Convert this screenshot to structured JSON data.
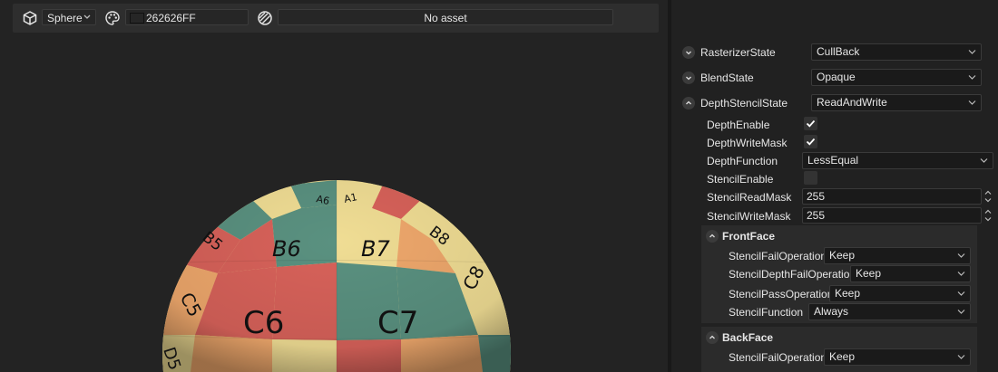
{
  "toolbar": {
    "shape_value": "Sphere",
    "color_value": "262626FF",
    "color_swatch": "#262626",
    "asset_value": "No asset"
  },
  "sphere_tiles": {
    "row_a": [
      "A6",
      "A1"
    ],
    "row_b": [
      "B5",
      "B6",
      "B7",
      "B8"
    ],
    "row_c": [
      "C5",
      "C6",
      "C7",
      "C8"
    ],
    "row_d": [
      "D5"
    ],
    "colors": {
      "red": "#d8625a",
      "teal": "#5a9180",
      "yellow": "#f0dd94",
      "orange": "#efa86c"
    }
  },
  "props": {
    "rasterizer": {
      "label": "RasterizerState",
      "value": "CullBack"
    },
    "blend": {
      "label": "BlendState",
      "value": "Opaque"
    },
    "depth_stencil": {
      "label": "DepthStencilState",
      "value": "ReadAndWrite",
      "depth_enable": {
        "label": "DepthEnable",
        "checked": true
      },
      "depth_write_mask": {
        "label": "DepthWriteMask",
        "checked": true
      },
      "depth_function": {
        "label": "DepthFunction",
        "value": "LessEqual"
      },
      "stencil_enable": {
        "label": "StencilEnable",
        "checked": false
      },
      "stencil_read_mask": {
        "label": "StencilReadMask",
        "value": "255"
      },
      "stencil_write_mask": {
        "label": "StencilWriteMask",
        "value": "255"
      },
      "front_face": {
        "label": "FrontFace",
        "fail_op": {
          "label": "StencilFailOperation",
          "value": "Keep"
        },
        "depth_fail_op": {
          "label": "StencilDepthFailOperation",
          "value": "Keep"
        },
        "pass_op": {
          "label": "StencilPassOperation",
          "value": "Keep"
        },
        "function": {
          "label": "StencilFunction",
          "value": "Always"
        }
      },
      "back_face": {
        "label": "BackFace",
        "fail_op": {
          "label": "StencilFailOperation",
          "value": "Keep"
        }
      }
    }
  }
}
